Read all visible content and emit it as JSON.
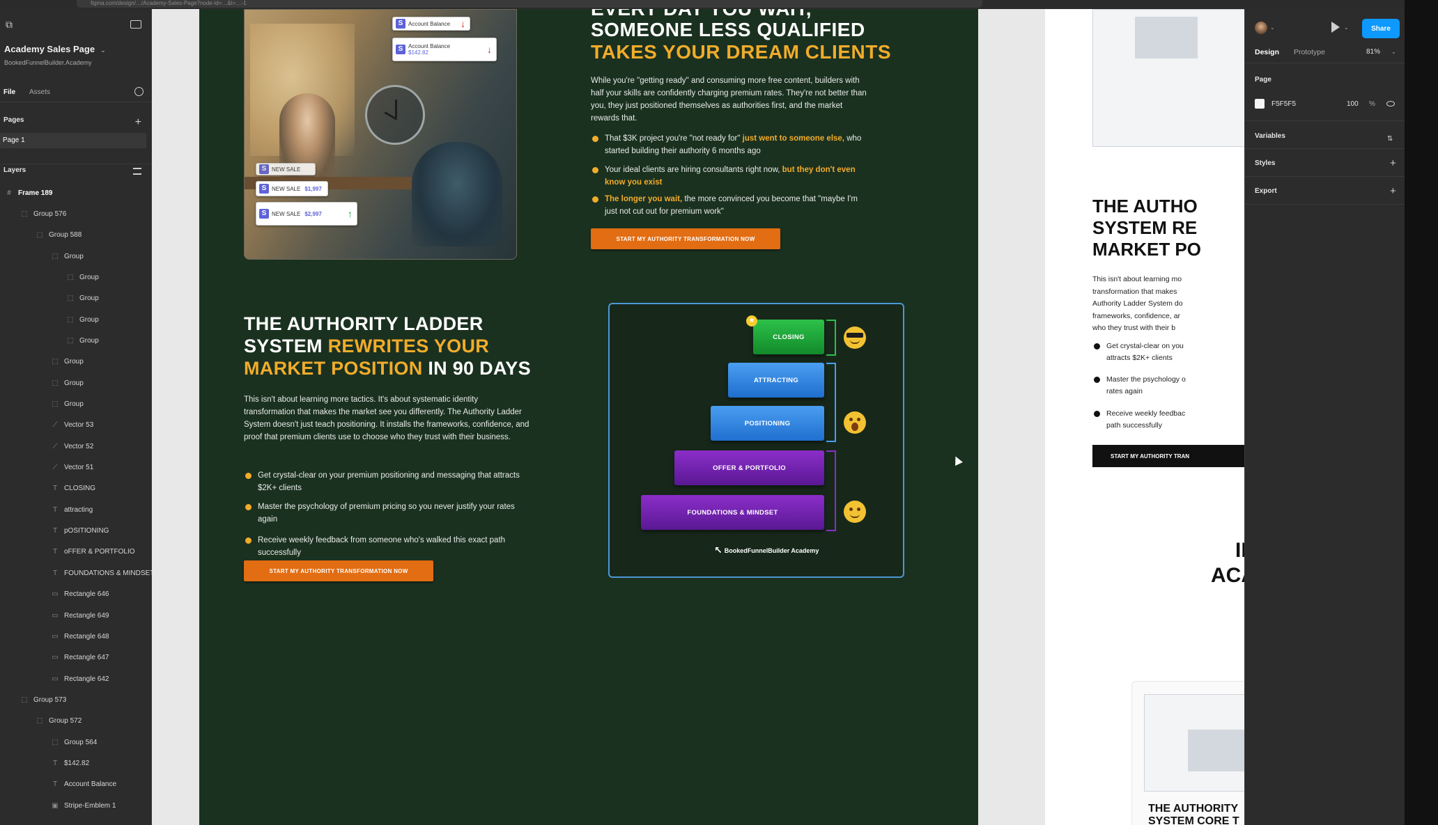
{
  "browser": {
    "url": "figma.com/design/…/Academy-Sales-Page?node-id=…&t=…-1"
  },
  "left_panel": {
    "file_title": "Academy Sales Page",
    "file_sub": "BookedFunnelBuilder.Academy",
    "tabs": {
      "file": "File",
      "assets": "Assets"
    },
    "pages_label": "Pages",
    "page1": "Page 1",
    "layers_label": "Layers",
    "layers": [
      {
        "label": "Frame 189",
        "indent": 0,
        "icon": "#"
      },
      {
        "label": "Group 576",
        "indent": 1,
        "icon": "⬚"
      },
      {
        "label": "Group 588",
        "indent": 2,
        "icon": "⬚"
      },
      {
        "label": "Group",
        "indent": 3,
        "icon": "⬚"
      },
      {
        "label": "Group",
        "indent": 4,
        "icon": "⬚"
      },
      {
        "label": "Group",
        "indent": 4,
        "icon": "⬚"
      },
      {
        "label": "Group",
        "indent": 4,
        "icon": "⬚"
      },
      {
        "label": "Group",
        "indent": 4,
        "icon": "⬚"
      },
      {
        "label": "Group",
        "indent": 3,
        "icon": "⬚"
      },
      {
        "label": "Group",
        "indent": 3,
        "icon": "⬚"
      },
      {
        "label": "Group",
        "indent": 3,
        "icon": "⬚"
      },
      {
        "label": "Vector 53",
        "indent": 3,
        "icon": "⟋"
      },
      {
        "label": "Vector 52",
        "indent": 3,
        "icon": "⟋"
      },
      {
        "label": "Vector 51",
        "indent": 3,
        "icon": "⟋"
      },
      {
        "label": "CLOSING",
        "indent": 3,
        "icon": "T"
      },
      {
        "label": "attracting",
        "indent": 3,
        "icon": "T"
      },
      {
        "label": "pOSITIONING",
        "indent": 3,
        "icon": "T"
      },
      {
        "label": "oFFER & PORTFOLIO",
        "indent": 3,
        "icon": "T"
      },
      {
        "label": "FOUNDATIONS & MINDSET",
        "indent": 3,
        "icon": "T"
      },
      {
        "label": "Rectangle 646",
        "indent": 3,
        "icon": "▭"
      },
      {
        "label": "Rectangle 649",
        "indent": 3,
        "icon": "▭"
      },
      {
        "label": "Rectangle 648",
        "indent": 3,
        "icon": "▭"
      },
      {
        "label": "Rectangle 647",
        "indent": 3,
        "icon": "▭"
      },
      {
        "label": "Rectangle 642",
        "indent": 3,
        "icon": "▭"
      },
      {
        "label": "Group 573",
        "indent": 1,
        "icon": "⬚"
      },
      {
        "label": "Group 572",
        "indent": 2,
        "icon": "⬚"
      },
      {
        "label": "Group 564",
        "indent": 3,
        "icon": "⬚"
      },
      {
        "label": "$142.82",
        "indent": 3,
        "icon": "T"
      },
      {
        "label": "Account Balance",
        "indent": 3,
        "icon": "T"
      },
      {
        "label": "Stripe-Emblem 1",
        "indent": 3,
        "icon": "▣"
      }
    ]
  },
  "hero": {
    "headline_partial": "EVERY DAY YOU WAIT,",
    "headline_white": "SOMEONE LESS QUALIFIED",
    "headline_yellow": "TAKES YOUR DREAM CLIENTS",
    "paragraph": "While you're \"getting ready\" and consuming more free content, builders with half your skills are confidently charging premium rates. They're not better than you, they just positioned themselves as authorities first, and the market rewards that.",
    "bullets": [
      {
        "pre": "That $3K project you're \"not ready for\" ",
        "hl": "just went to someone else,",
        "post": " who started building their authority 6 months ago"
      },
      {
        "pre": "Your ideal clients are hiring consultants right now, ",
        "hl": "but they don't even know you exist",
        "post": ""
      },
      {
        "pre": "",
        "hl": "The longer you wait,",
        "post": " the more convinced you become that \"maybe I'm just not cut out for premium work\""
      }
    ],
    "cta": "START MY AUTHORITY TRANSFORMATION NOW",
    "badges": [
      {
        "label": "Account Balance",
        "amount": "",
        "dir": "down"
      },
      {
        "label": "Account Balance",
        "amount": "$142.82",
        "dir": "down"
      },
      {
        "label": "NEW SALE",
        "amount": "",
        "dir": "up"
      },
      {
        "label": "NEW SALE",
        "amount": "$1,997",
        "dir": "up"
      },
      {
        "label": "NEW SALE",
        "amount": "$2,997",
        "dir": "up"
      }
    ]
  },
  "authority": {
    "h_white1": "THE AUTHORITY LADDER SYSTEM ",
    "h_yellow": "REWRITES YOUR MARKET POSITION",
    "h_white2": " IN 90 DAYS",
    "paragraph": "This isn't about learning more tactics. It's about systematic identity transformation that makes the market see you differently. The Authority Ladder System doesn't just teach positioning. It installs the frameworks, confidence, and proof that premium clients use to choose who they trust with their business.",
    "bullets": [
      "Get crystal-clear on your premium positioning and messaging that attracts $2K+ clients",
      "Master the psychology of premium pricing so you never justify your rates again",
      "Receive weekly feedback from someone who's walked this exact path successfully"
    ],
    "cta": "START MY AUTHORITY TRANSFORMATION NOW",
    "ladder": {
      "steps": [
        "CLOSING",
        "ATTRACTING",
        "POSITIONING",
        "OFFER & PORTFOLIO",
        "FOUNDATIONS & MINDSET"
      ],
      "logo": "BookedFunnelBuilder Academy"
    }
  },
  "white_frame": {
    "h_lines": [
      "THE AUTHO",
      "SYSTEM RE",
      "MARKET PO"
    ],
    "p_lines": [
      "This isn't about learning mo",
      "transformation that makes",
      "Authority Ladder System do",
      "frameworks, confidence, ar",
      "who they trust with their b"
    ],
    "bullets": [
      [
        "Get crystal-clear on you",
        "attracts $2K+ clients"
      ],
      [
        "Master the psychology o",
        "rates again"
      ],
      [
        "Receive weekly feedbac",
        "path successfully"
      ]
    ],
    "cta": "START MY AUTHORITY TRAN",
    "h2_lines": [
      "IN",
      "ACA"
    ],
    "h3_lines": [
      "THE AUTHORITY",
      "SYSTEM CORE T"
    ]
  },
  "right_panel": {
    "share": "Share",
    "tabs": {
      "design": "Design",
      "prototype": "Prototype"
    },
    "zoom": "81%",
    "page_label": "Page",
    "page_color": "F5F5F5",
    "page_opacity": "100",
    "pct": "%",
    "variables": "Variables",
    "styles": "Styles",
    "export": "Export"
  },
  "colors": {
    "dark_green": "#1b3120",
    "accent_yellow": "#f1ac2b",
    "cta_orange": "#e26d13",
    "figma_blue": "#0d99ff"
  }
}
